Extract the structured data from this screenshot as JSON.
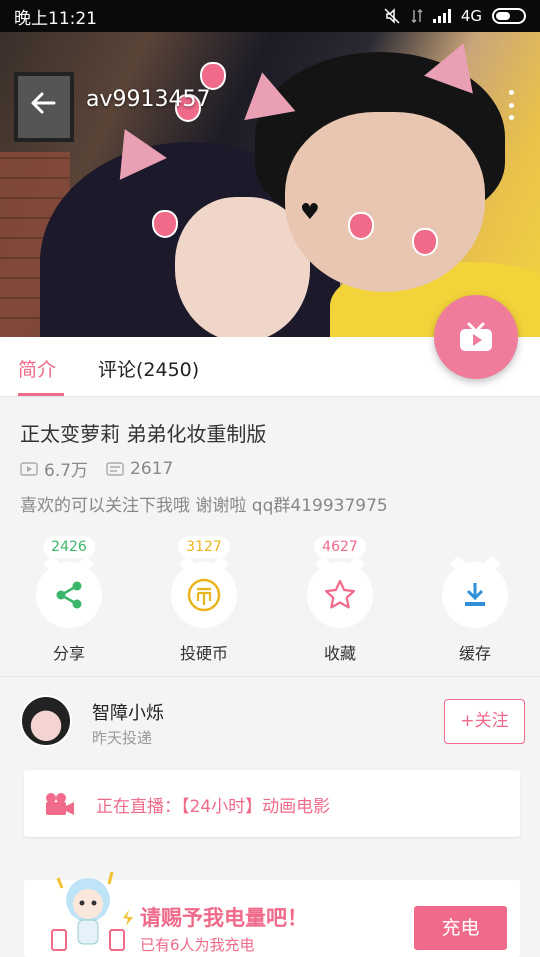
{
  "status_bar": {
    "time": "晚上11:21",
    "network": "4G"
  },
  "header": {
    "title": "av9913457"
  },
  "tabs": [
    {
      "label": "简介"
    },
    {
      "label": "评论(2450)"
    }
  ],
  "video": {
    "title": "正太变萝莉 弟弟化妆重制版",
    "views": "6.7万",
    "danmaku": "2617",
    "description": "喜欢的可以关注下我哦 谢谢啦 qq群419937975"
  },
  "actions": [
    {
      "label": "分享",
      "count": "2426",
      "color": "#3bb76a",
      "icon": "share-icon"
    },
    {
      "label": "投硬币",
      "count": "3127",
      "color": "#e9b51c",
      "icon": "coin-icon"
    },
    {
      "label": "收藏",
      "count": "4627",
      "color": "#f06a8a",
      "icon": "star-icon"
    },
    {
      "label": "缓存",
      "count": "",
      "color": "#2f8fd8",
      "icon": "download-icon"
    }
  ],
  "uploader": {
    "name": "智障小烁",
    "time": "昨天投递",
    "follow_label": "+关注"
  },
  "live": {
    "text": "正在直播：【24小时】动画电影"
  },
  "charge": {
    "title": "请赐予我电量吧！",
    "subtitle": "已有6人为我充电",
    "button_label": "充电"
  },
  "colors": {
    "accent": "#f06a8a",
    "status_bg": "#0a0a0a"
  }
}
